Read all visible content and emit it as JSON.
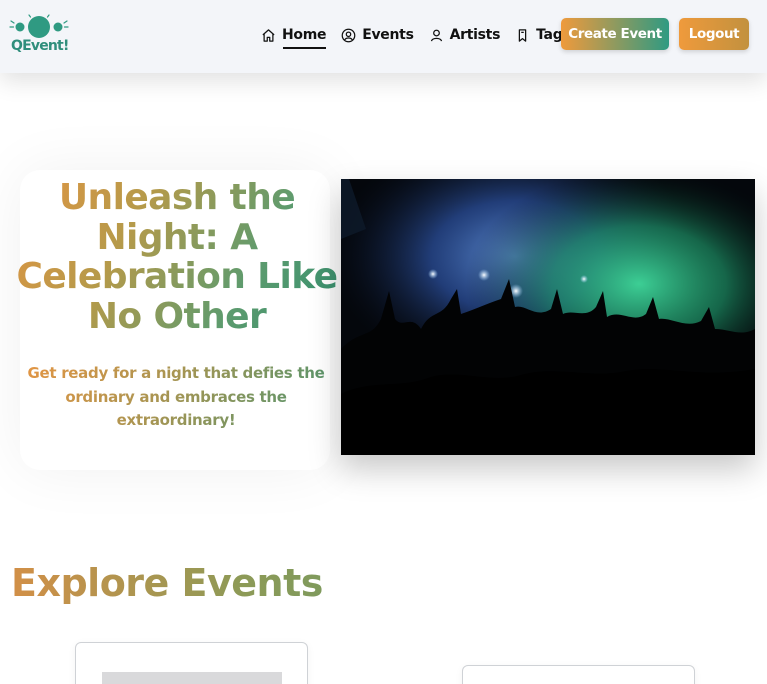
{
  "app": {
    "logo_text": "QEvent!"
  },
  "nav": {
    "items": [
      {
        "label": "Home",
        "icon": "home-icon",
        "active": true
      },
      {
        "label": "Events",
        "icon": "user-circle-icon",
        "active": false
      },
      {
        "label": "Artists",
        "icon": "user-icon",
        "active": false
      },
      {
        "label": "Tags",
        "icon": "bookmark-icon",
        "active": false
      }
    ],
    "create_label": "Create Event",
    "logout_label": "Logout"
  },
  "hero": {
    "title": "Unleash the Night: A Celebration Like No Other",
    "subtitle": "Get ready for a night that defies the ordinary and embraces the extraordinary!",
    "image": "concert-crowd-photo"
  },
  "explore": {
    "title": "Explore Events"
  },
  "colors": {
    "accent_orange": "#ef9a3c",
    "accent_green": "#2f9a82",
    "header_bg": "#f3f5f9"
  }
}
